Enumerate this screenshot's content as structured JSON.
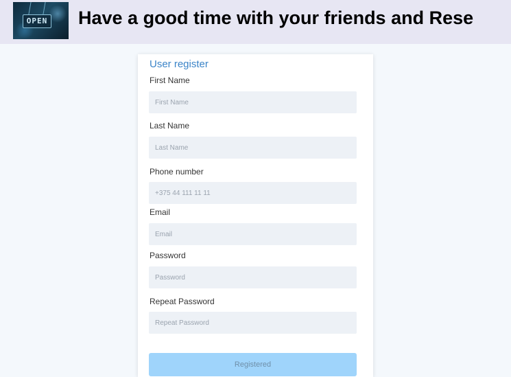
{
  "header": {
    "logo_text": "OPEN",
    "title": "Have a good time with your friends and Rese"
  },
  "form": {
    "title": "User register",
    "fields": [
      {
        "label": "First Name",
        "placeholder": "First Name"
      },
      {
        "label": "Last Name",
        "placeholder": "Last Name"
      },
      {
        "label": "Phone number",
        "placeholder": "+375 44 111 11 11"
      },
      {
        "label": "Email",
        "placeholder": "Email"
      },
      {
        "label": "Password",
        "placeholder": "Password"
      },
      {
        "label": "Repeat Password",
        "placeholder": "Repeat Password"
      }
    ],
    "submit_label": "Registered"
  }
}
